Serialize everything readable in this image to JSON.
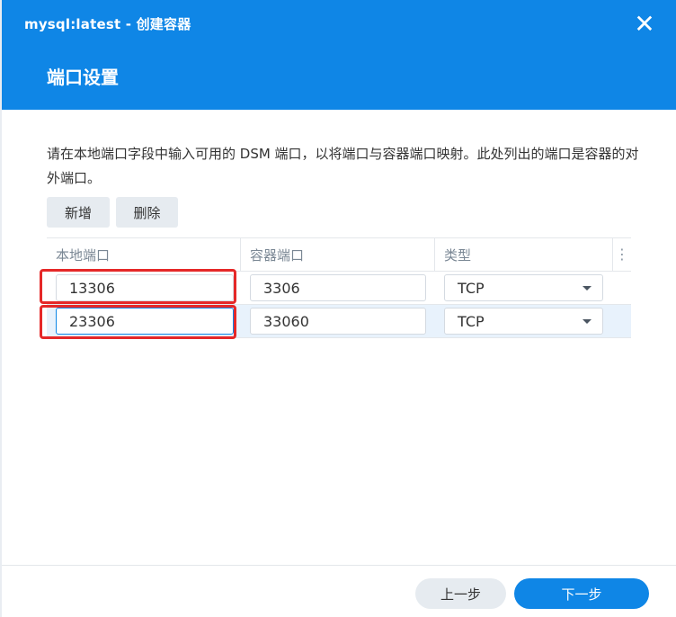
{
  "window": {
    "title": "mysql:latest - 创建容器",
    "close_glyph": "✕"
  },
  "section": {
    "title": "端口设置"
  },
  "description": "请在本地端口字段中输入可用的 DSM 端口，以将端口与容器端口映射。此处列出的端口是容器的对外端口。",
  "toolbar": {
    "add_label": "新增",
    "delete_label": "删除"
  },
  "table": {
    "columns": [
      "本地端口",
      "容器端口",
      "类型"
    ],
    "column_menu_glyph": "⋮",
    "rows": [
      {
        "local_port": "13306",
        "container_port": "3306",
        "type": "TCP",
        "selected": false
      },
      {
        "local_port": "23306",
        "container_port": "33060",
        "type": "TCP",
        "selected": true
      }
    ]
  },
  "footer": {
    "prev_label": "上一步",
    "next_label": "下一步"
  },
  "colors": {
    "accent": "#0f86e6",
    "highlight": "#e52828"
  }
}
